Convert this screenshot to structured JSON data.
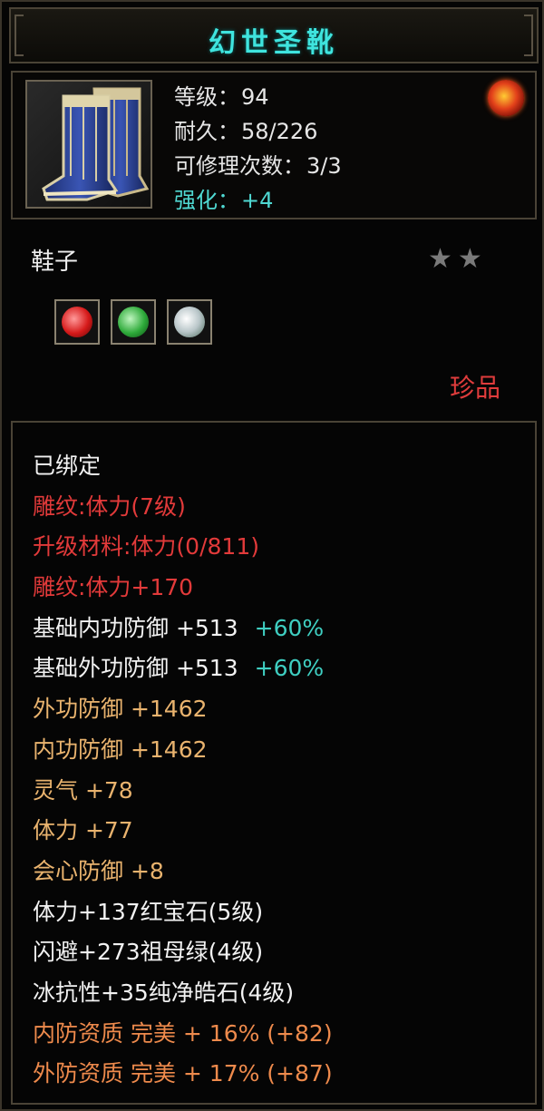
{
  "item": {
    "name": "幻世圣靴",
    "type": "鞋子",
    "rarity": "珍品",
    "stars": "★★",
    "header_stats": [
      {
        "label": "等级：",
        "value": "94",
        "color": "#e6e6e6"
      },
      {
        "label": "耐久：",
        "value": "58/226",
        "color": "#e6e6e6"
      },
      {
        "label": "可修理次数：",
        "value": "3/3",
        "color": "#e6e6e6"
      },
      {
        "label": "强化：",
        "value": "+4",
        "color": "#4fd8d2"
      }
    ],
    "sockets": [
      {
        "icon": "ruby-gem-icon"
      },
      {
        "icon": "emerald-gem-icon"
      },
      {
        "icon": "diamond-gem-icon"
      }
    ],
    "badge_icon": "fire-dragon-icon"
  },
  "attributes": [
    {
      "text": "已绑定",
      "extra": "",
      "color": "white"
    },
    {
      "text": "雕纹:体力(7级)",
      "extra": "",
      "color": "red"
    },
    {
      "text": "升级材料:体力(0/811)",
      "extra": "",
      "color": "red"
    },
    {
      "text": "雕纹:体力+170",
      "extra": "",
      "color": "red"
    },
    {
      "text": "基础内功防御 +513",
      "extra": "+60%",
      "color": "white"
    },
    {
      "text": "基础外功防御 +513",
      "extra": "+60%",
      "color": "white"
    },
    {
      "text": "外功防御 +1462",
      "extra": "",
      "color": "gold"
    },
    {
      "text": "内功防御 +1462",
      "extra": "",
      "color": "gold"
    },
    {
      "text": "灵气 +78",
      "extra": "",
      "color": "gold"
    },
    {
      "text": "体力 +77",
      "extra": "",
      "color": "gold"
    },
    {
      "text": "会心防御 +8",
      "extra": "",
      "color": "gold"
    },
    {
      "text": "体力+137红宝石(5级)",
      "extra": "",
      "color": "white"
    },
    {
      "text": "闪避+273祖母绿(4级)",
      "extra": "",
      "color": "white"
    },
    {
      "text": "冰抗性+35纯净皓石(4级)",
      "extra": "",
      "color": "white"
    },
    {
      "text": "内防资质 完美 + 16% (+82)",
      "extra": "",
      "color": "orange"
    },
    {
      "text": "外防资质 完美 + 17% (+87)",
      "extra": "",
      "color": "orange"
    }
  ],
  "colors": {
    "title": "#3fe4de",
    "red": "#e23a3a",
    "gold": "#e9b36e",
    "orange": "#ee8a4c",
    "cyan": "#3fcfc2",
    "white": "#f2f2f2"
  }
}
